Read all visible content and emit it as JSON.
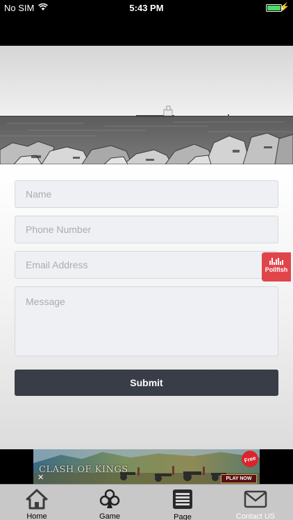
{
  "status_bar": {
    "carrier": "No SIM",
    "time": "5:43 PM"
  },
  "form": {
    "name_placeholder": "Name",
    "phone_placeholder": "Phone Number",
    "email_placeholder": "Email Address",
    "message_placeholder": "Message",
    "submit_label": "Submit"
  },
  "pollfish": {
    "label": "Pollfish"
  },
  "ad": {
    "title": "CLASH OF KINGS",
    "badge": "Free",
    "cta": "PLAY NOW",
    "close": "✕"
  },
  "tab_bar": {
    "items": [
      {
        "label": "Home",
        "icon": "home-icon"
      },
      {
        "label": "Game",
        "icon": "club-icon"
      },
      {
        "label": "Page",
        "icon": "list-page-icon"
      },
      {
        "label": "Contact US",
        "icon": "envelope-icon"
      }
    ]
  }
}
